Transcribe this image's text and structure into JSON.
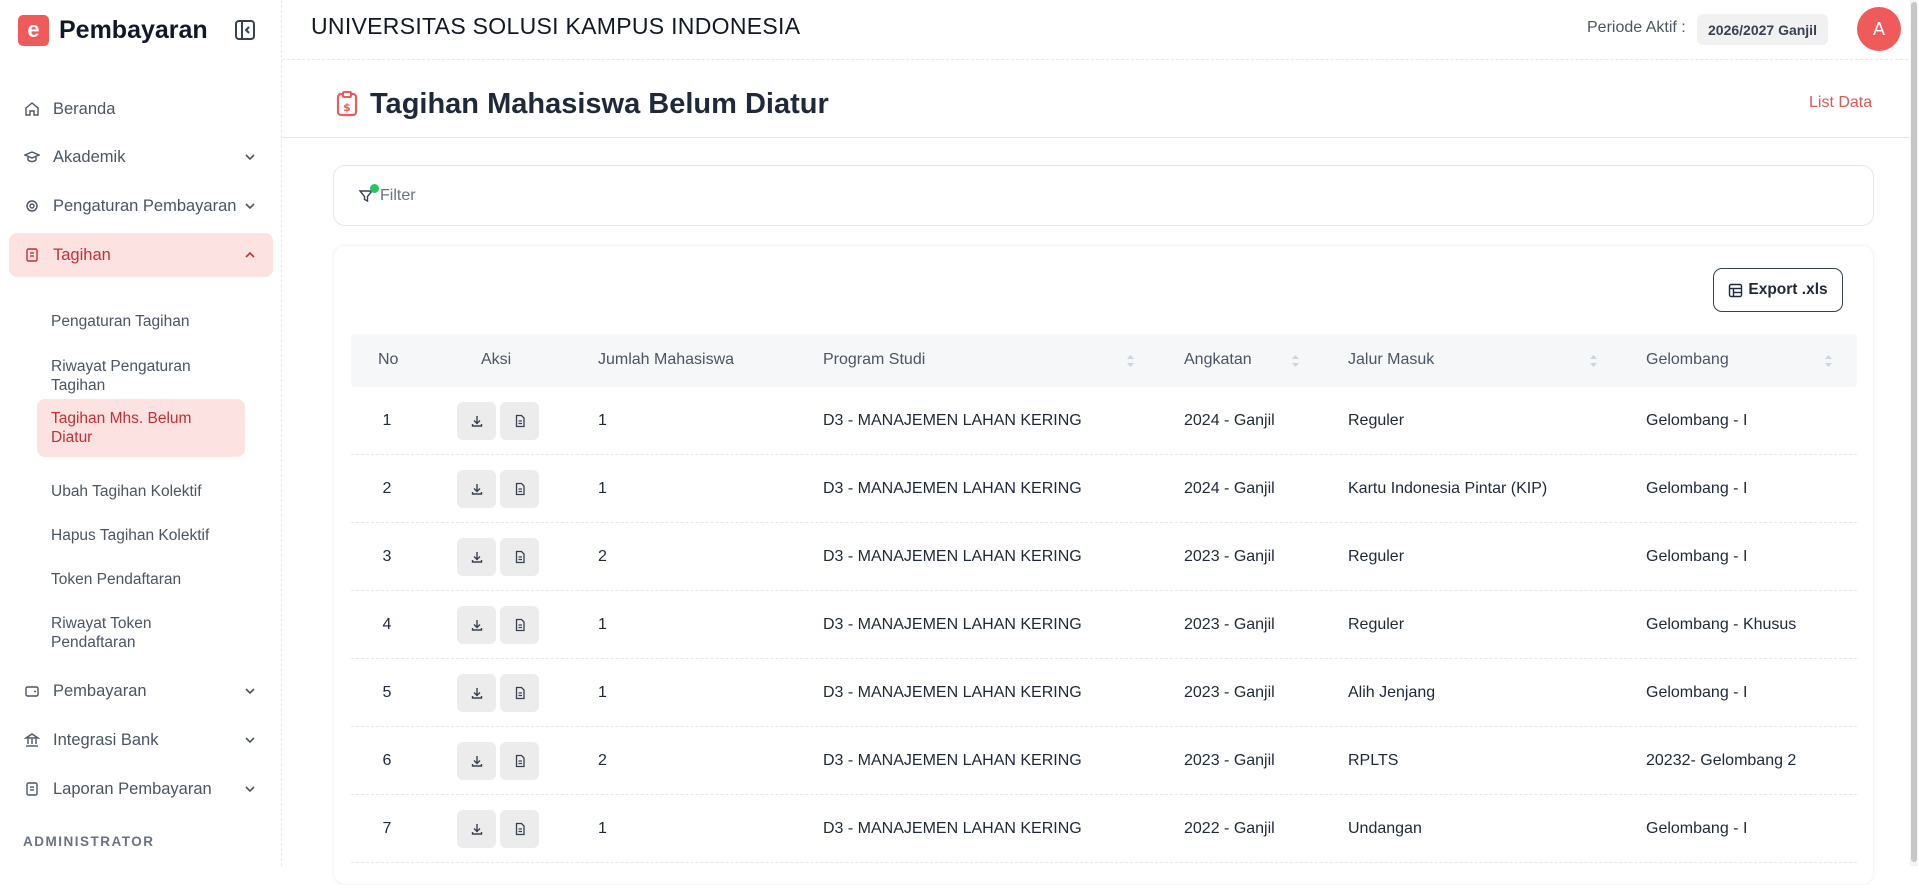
{
  "app": {
    "brand_name": "Pembayaran",
    "brand_letter": "e"
  },
  "sidebar": {
    "items": [
      {
        "label": "Beranda",
        "icon": "home-icon"
      },
      {
        "label": "Akademik",
        "icon": "graduation-cap-icon"
      },
      {
        "label": "Pengaturan Pembayaran",
        "icon": "settings-icon"
      },
      {
        "label": "Tagihan",
        "icon": "invoice-icon"
      },
      {
        "label": "Pembayaran",
        "icon": "wallet-icon"
      },
      {
        "label": "Integrasi Bank",
        "icon": "bank-icon"
      },
      {
        "label": "Laporan Pembayaran",
        "icon": "report-icon"
      }
    ],
    "tagihan_sub": [
      "Pengaturan Tagihan",
      "Riwayat Pengaturan Tagihan",
      "Tagihan Mhs. Belum Diatur",
      "Ubah Tagihan Kolektif",
      "Hapus Tagihan Kolektif",
      "Token Pendaftaran",
      "Riwayat Token Pendaftaran"
    ],
    "section_label": "ADMINISTRATOR"
  },
  "header": {
    "university": "UNIVERSITAS SOLUSI KAMPUS INDONESIA",
    "periode_label": "Periode Aktif :",
    "periode_value": "2026/2027 Ganjil",
    "avatar_initial": "A"
  },
  "page": {
    "title": "Tagihan Mahasiswa Belum Diatur",
    "list_data_link": "List Data",
    "filter_label": "Filter",
    "export_label": "Export .xls"
  },
  "table": {
    "headers": [
      "No",
      "Aksi",
      "Jumlah Mahasiswa",
      "Program Studi",
      "Angkatan",
      "Jalur Masuk",
      "Gelombang"
    ],
    "rows": [
      {
        "no": "1",
        "jumlah": "1",
        "prodi": "D3 - MANAJEMEN LAHAN KERING",
        "angkatan": "2024 - Ganjil",
        "jalur": "Reguler",
        "gelombang": "Gelombang - I"
      },
      {
        "no": "2",
        "jumlah": "1",
        "prodi": "D3 - MANAJEMEN LAHAN KERING",
        "angkatan": "2024 - Ganjil",
        "jalur": "Kartu Indonesia Pintar (KIP)",
        "gelombang": "Gelombang - I"
      },
      {
        "no": "3",
        "jumlah": "2",
        "prodi": "D3 - MANAJEMEN LAHAN KERING",
        "angkatan": "2023 - Ganjil",
        "jalur": "Reguler",
        "gelombang": "Gelombang - I"
      },
      {
        "no": "4",
        "jumlah": "1",
        "prodi": "D3 - MANAJEMEN LAHAN KERING",
        "angkatan": "2023 - Ganjil",
        "jalur": "Reguler",
        "gelombang": "Gelombang - Khusus"
      },
      {
        "no": "5",
        "jumlah": "1",
        "prodi": "D3 - MANAJEMEN LAHAN KERING",
        "angkatan": "2023 - Ganjil",
        "jalur": "Alih Jenjang",
        "gelombang": "Gelombang - I"
      },
      {
        "no": "6",
        "jumlah": "2",
        "prodi": "D3 - MANAJEMEN LAHAN KERING",
        "angkatan": "2023 - Ganjil",
        "jalur": "RPLTS",
        "gelombang": "20232- Gelombang 2"
      },
      {
        "no": "7",
        "jumlah": "1",
        "prodi": "D3 - MANAJEMEN LAHAN KERING",
        "angkatan": "2022 - Ganjil",
        "jalur": "Undangan",
        "gelombang": "Gelombang - I"
      }
    ]
  },
  "colors": {
    "accent": "#ef5b5b",
    "active_bg": "#fde2e2",
    "active_text": "#c53030",
    "filter_dot": "#22c55e"
  }
}
